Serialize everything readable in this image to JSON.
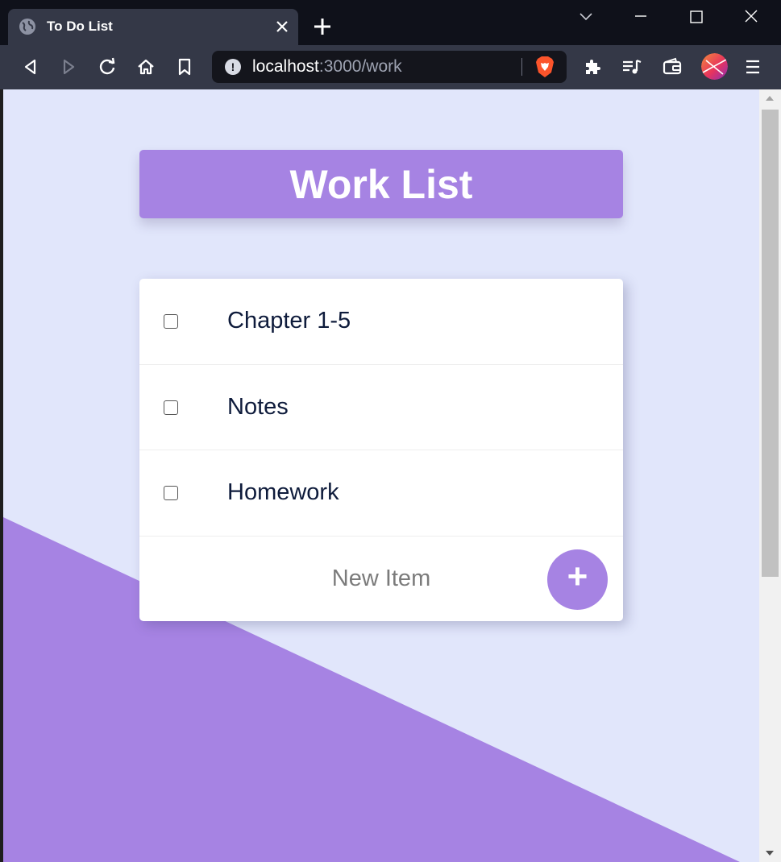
{
  "browser": {
    "tab": {
      "title": "To Do List",
      "icon": "globe-icon"
    },
    "address": {
      "host": "localhost",
      "rest": ":3000/work"
    },
    "colors": {
      "chrome": "#343847",
      "titlebar": "#0f111a",
      "brave": "#fb542b"
    }
  },
  "page": {
    "title": "Work List",
    "items": [
      {
        "label": "Chapter 1-5",
        "checked": false
      },
      {
        "label": "Notes",
        "checked": false
      },
      {
        "label": "Homework",
        "checked": false
      }
    ],
    "new_item_placeholder": "New Item",
    "add_button_label": "+",
    "colors": {
      "accent": "#a683e3",
      "background": "#e1e6fb",
      "text": "#0e1b3b"
    }
  }
}
